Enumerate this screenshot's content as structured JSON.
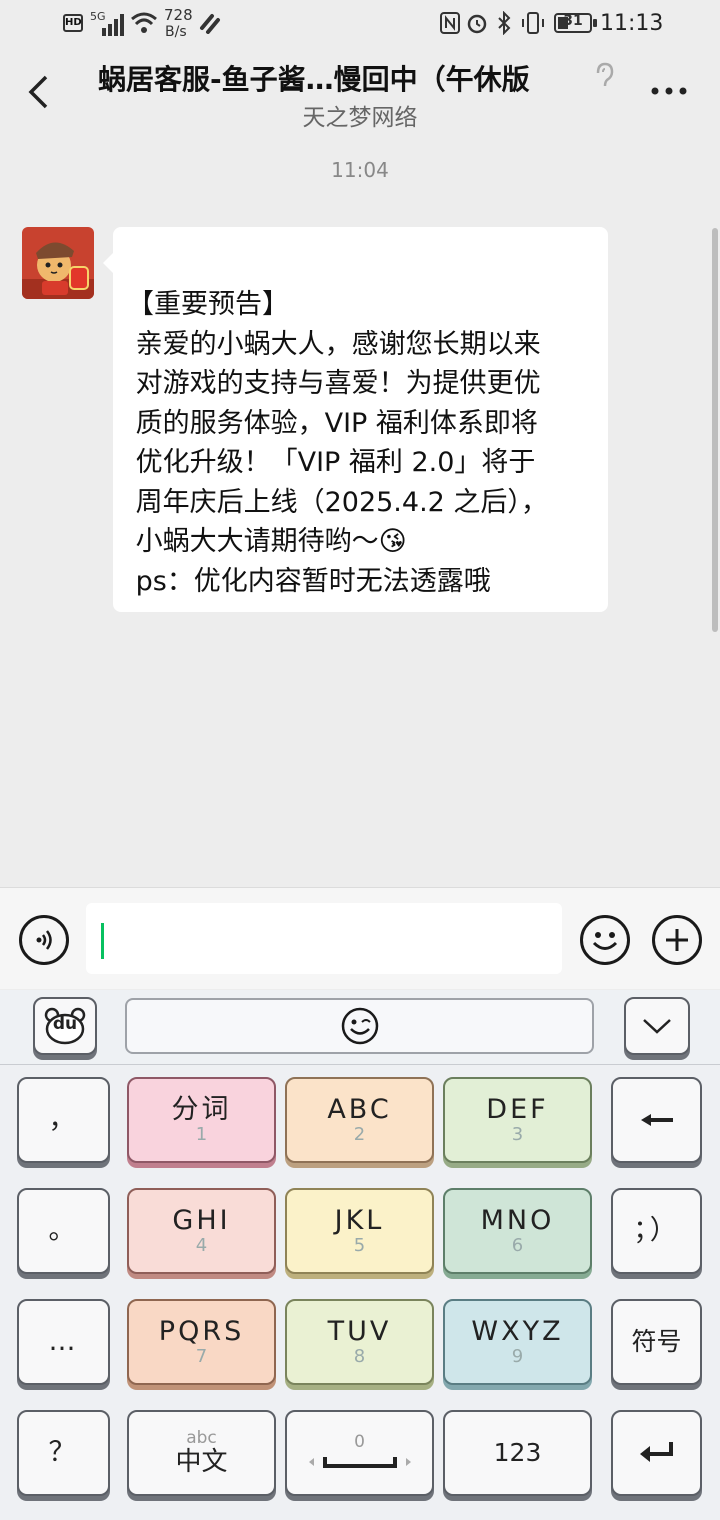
{
  "status_bar": {
    "hd": "HD",
    "network": "5G",
    "speed_value": "728",
    "speed_unit": "B/s",
    "battery": "31",
    "time": "11:13"
  },
  "header": {
    "title": "蜗居客服-鱼子酱…慢回中（午休版",
    "subtitle": "天之梦网络"
  },
  "chat": {
    "timestamp": "11:04",
    "message": "【重要预告】\n 亲爱的小蜗大人，感谢您长期以来\n 对游戏的支持与喜爱！为提供更优\n 质的服务体验，VIP 福利体系即将\n 优化升级！「VIP 福利 2.0」将于\n 周年庆后上线（2025.4.2 之后），\n 小蜗大大请期待哟～😘\n ps：优化内容暂时无法透露哦"
  },
  "input": {
    "value": "",
    "voice_icon": "voice-icon",
    "emoji_icon": "emoji-icon",
    "plus_icon": "plus-icon"
  },
  "keyboard": {
    "logo": "du",
    "rows": [
      [
        {
          "main": "，",
          "sub": ""
        },
        {
          "main": "分词",
          "sub": "1"
        },
        {
          "main": "ABC",
          "sub": "2"
        },
        {
          "main": "DEF",
          "sub": "3"
        },
        {
          "main": "←",
          "sub": ""
        }
      ],
      [
        {
          "main": "。",
          "sub": ""
        },
        {
          "main": "GHI",
          "sub": "4"
        },
        {
          "main": "JKL",
          "sub": "5"
        },
        {
          "main": "MNO",
          "sub": "6"
        },
        {
          "main": "；）",
          "sub": ""
        }
      ],
      [
        {
          "main": "…",
          "sub": ""
        },
        {
          "main": "PQRS",
          "sub": "7"
        },
        {
          "main": "TUV",
          "sub": "8"
        },
        {
          "main": "WXYZ",
          "sub": "9"
        },
        {
          "main": "符号",
          "sub": ""
        }
      ],
      [
        {
          "main": "？",
          "sub": ""
        },
        {
          "top": "abc",
          "main": "中文"
        },
        {
          "top": "0",
          "main": "space"
        },
        {
          "main": "123"
        },
        {
          "main": "enter"
        }
      ]
    ],
    "colors": {
      "fenci": "#f9d3dd",
      "abc": "#fbe3c9",
      "def": "#e2efd6",
      "ghi": "#f9dcd7",
      "jkl": "#fbf2c9",
      "mno": "#cfe5d7",
      "pqrs": "#f9d8c5",
      "tuv": "#eaf1d3",
      "wxyz": "#cfe6ea",
      "plain": "#f8f8f9"
    }
  }
}
